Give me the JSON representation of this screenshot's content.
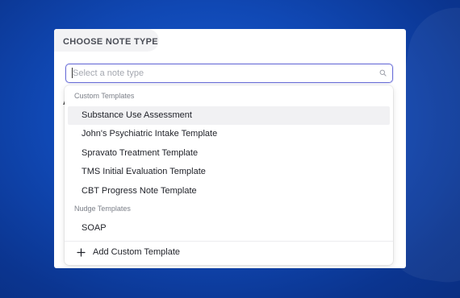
{
  "panel": {
    "title": "CHOOSE NOTE TYPE",
    "hidden_label_char": "A"
  },
  "select": {
    "placeholder": "Select a note type",
    "value": "",
    "icon": "search-icon"
  },
  "dropdown": {
    "custom_label": "Custom Templates",
    "custom_options": [
      "Substance Use Assessment",
      "John's Psychiatric Intake Template",
      "Spravato Treatment Template",
      "TMS Initial Evaluation Template",
      "CBT Progress Note Template"
    ],
    "highlighted_index": 0,
    "nudge_label": "Nudge Templates",
    "nudge_options": [
      "SOAP"
    ],
    "add_label": "Add Custom Template",
    "add_icon": "plus-icon"
  },
  "colors": {
    "background": "#1048b4",
    "focus_border": "#6b6fd8",
    "highlight": "#f1f1f3"
  }
}
